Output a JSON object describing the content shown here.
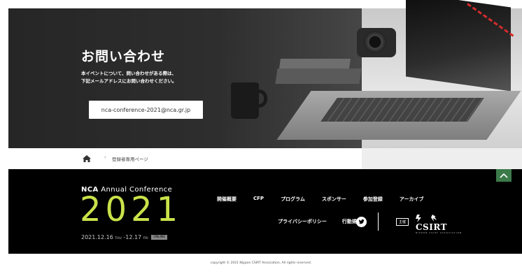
{
  "hero": {
    "title": "お問い合わせ",
    "description_line1": "本イベントについて、問い合わせがある際は、",
    "description_line2": "下記メールアドレスにお問い合わせください。",
    "email": "nca-conference-2021@nca.gr.jp"
  },
  "breadcrumb": {
    "separator": "›",
    "current": "登録者専用ページ"
  },
  "footer": {
    "brand_prefix": "NCA",
    "brand_suffix": "Annual Conference",
    "year": "2021",
    "date_start": "2021.12.16",
    "date_start_day": "THU",
    "date_end": "-12.17",
    "date_end_day": "FRI",
    "badge": "ONLINE",
    "nav_row1": [
      "開催概要",
      "CFP",
      "プログラム",
      "スポンサー",
      "参加登録",
      "アーカイブ"
    ],
    "nav_row2": [
      "プライバシーポリシー",
      "行動規範"
    ],
    "organizer_label": "主催",
    "csirt_text": "CSIRT",
    "csirt_sub": "NIPPON CSIRT ASSOCIATION"
  },
  "copyright": "copyright © 2021 Nippon CSIRT Association, All rights reserved.",
  "colors": {
    "accent_green": "#c9e24a",
    "scroll_button": "#3c7a4a",
    "footer_bg": "#000000"
  }
}
